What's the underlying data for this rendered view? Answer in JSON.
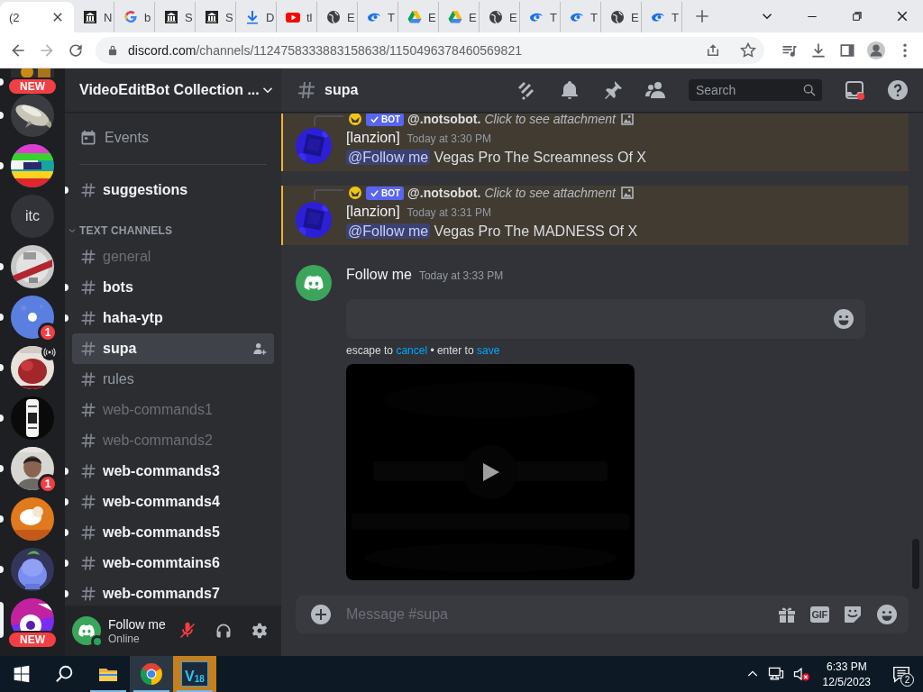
{
  "browser": {
    "tabs": [
      {
        "label": "(2",
        "selected": true
      },
      {
        "label": "N",
        "kind": "bank",
        "selected": false
      },
      {
        "label": "b",
        "kind": "google",
        "selected": false
      },
      {
        "label": "S",
        "kind": "bank",
        "selected": false
      },
      {
        "label": "S",
        "kind": "bank",
        "selected": false
      },
      {
        "label": "D",
        "kind": "download",
        "selected": false
      },
      {
        "label": "tl",
        "kind": "youtube",
        "selected": false
      },
      {
        "label": "E",
        "kind": "globe",
        "selected": false
      },
      {
        "label": "T",
        "kind": "swirl",
        "selected": false
      },
      {
        "label": "E",
        "kind": "drive",
        "selected": false
      },
      {
        "label": "E",
        "kind": "drive",
        "selected": false
      },
      {
        "label": "E",
        "kind": "globe",
        "selected": false
      },
      {
        "label": "T",
        "kind": "swirl",
        "selected": false
      },
      {
        "label": "T",
        "kind": "swirl",
        "selected": false
      },
      {
        "label": "E",
        "kind": "globe",
        "selected": false
      },
      {
        "label": "T",
        "kind": "swirl",
        "selected": false
      }
    ],
    "url_host": "discord.com",
    "url_path": "/channels/1124758333883158638/1150496378460569821"
  },
  "servers": [
    {
      "kind": "picture",
      "unread": true,
      "selected": false,
      "badge": {
        "kind": "pill",
        "text": "NEW"
      }
    },
    {
      "kind": "picture",
      "unread": true,
      "selected": false
    },
    {
      "kind": "picture",
      "unread": true,
      "selected": false
    },
    {
      "kind": "text",
      "label": "itc",
      "unread": false,
      "selected": false
    },
    {
      "kind": "picture",
      "unread": true,
      "selected": false
    },
    {
      "kind": "picture",
      "unread": true,
      "selected": false,
      "badge": {
        "kind": "count",
        "text": "1"
      }
    },
    {
      "kind": "picture",
      "unread": true,
      "selected": false,
      "live": true
    },
    {
      "kind": "picture",
      "unread": true,
      "selected": false
    },
    {
      "kind": "picture",
      "unread": true,
      "selected": false,
      "badge": {
        "kind": "count",
        "text": "1"
      }
    },
    {
      "kind": "picture",
      "unread": true,
      "selected": false
    },
    {
      "kind": "picture",
      "unread": true,
      "selected": false
    },
    {
      "kind": "picture",
      "unread": false,
      "selected": true,
      "badge": {
        "kind": "pill",
        "text": "NEW"
      }
    }
  ],
  "channel_list": {
    "header": "VideoEditBot Collection ...",
    "events": "Events",
    "top_channels": [
      {
        "name": "suggestions",
        "unread": true,
        "muted": false,
        "selected": false
      }
    ],
    "category": {
      "label": "TEXT CHANNELS",
      "expanded": true,
      "channels": [
        {
          "name": "general",
          "unread": false,
          "muted": true,
          "selected": false
        },
        {
          "name": "bots",
          "unread": true,
          "muted": false,
          "selected": false
        },
        {
          "name": "haha-ytp",
          "unread": true,
          "muted": false,
          "selected": false
        },
        {
          "name": "supa",
          "unread": false,
          "muted": false,
          "selected": true
        },
        {
          "name": "rules",
          "unread": false,
          "muted": false,
          "selected": false
        },
        {
          "name": "web-commands1",
          "unread": false,
          "muted": true,
          "selected": false
        },
        {
          "name": "web-commands2",
          "unread": false,
          "muted": true,
          "selected": false
        },
        {
          "name": "web-commands3",
          "unread": true,
          "muted": false,
          "selected": false
        },
        {
          "name": "web-commands4",
          "unread": true,
          "muted": false,
          "selected": false
        },
        {
          "name": "web-commands5",
          "unread": true,
          "muted": false,
          "selected": false
        },
        {
          "name": "web-commtains6",
          "unread": true,
          "muted": false,
          "selected": false
        },
        {
          "name": "web-commands7",
          "unread": true,
          "muted": false,
          "selected": false
        }
      ]
    }
  },
  "user_panel": {
    "name": "Follow me",
    "status": "Online",
    "mic_muted": true
  },
  "chat": {
    "channel": "supa",
    "search_placeholder": "Search",
    "messages": [
      {
        "avatar": {
          "kind": "picture"
        },
        "reply": {
          "tag": "BOT",
          "author": "@.notsobot.",
          "text": "Click to see attachment"
        },
        "author": "[lanzion]",
        "time": "Today at 3:30 PM",
        "mention": "@Follow me",
        "text": "Vegas Pro The Screamness Of X",
        "highlighted": true
      },
      {
        "avatar": {
          "kind": "picture"
        },
        "reply": {
          "tag": "BOT",
          "author": "@.notsobot.",
          "text": "Click to see attachment"
        },
        "author": "[lanzion]",
        "time": "Today at 3:31 PM",
        "mention": "@Follow me",
        "text": "Vegas Pro The MADNESS Of X",
        "highlighted": true
      },
      {
        "avatar": {
          "kind": "logo"
        },
        "author": "Follow me",
        "time": "Today at 3:33 PM",
        "highlighted": false,
        "edit": {
          "hint_start": "escape to",
          "cancel": "cancel",
          "hint_middle": "• enter to",
          "save": "save"
        },
        "attachment": {
          "kind": "picture"
        }
      }
    ],
    "composer": {
      "placeholder": "Message #supa",
      "gif_label": "GIF"
    }
  },
  "taskbar": {
    "apps": [
      {
        "kind": "explorer",
        "running": true,
        "active": false,
        "flashing": false
      },
      {
        "kind": "chrome",
        "running": true,
        "active": true,
        "flashing": false
      },
      {
        "kind": "vegas",
        "label": "V",
        "version": "18",
        "running": true,
        "active": false,
        "flashing": true
      }
    ],
    "time": "6:33 PM",
    "date": "12/5/2023",
    "notifications": "2"
  }
}
